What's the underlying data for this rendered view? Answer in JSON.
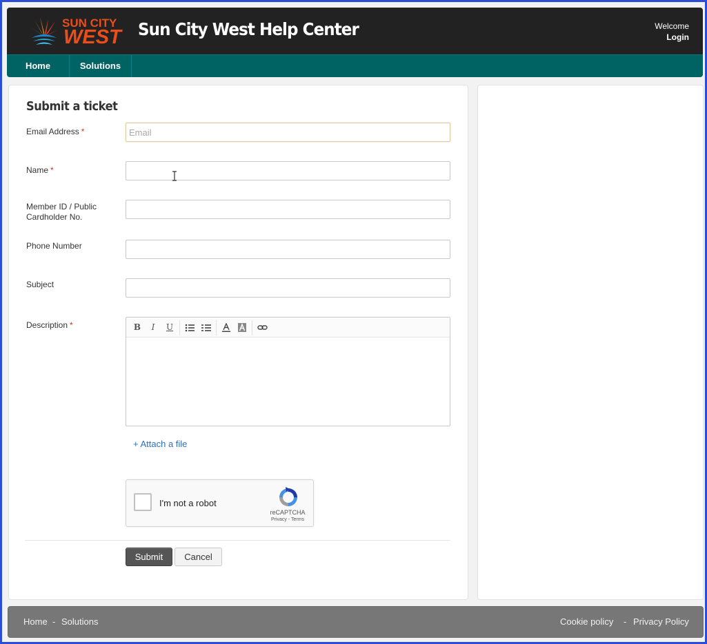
{
  "header": {
    "logo_top": "SUN CITY",
    "logo_bottom": "WEST",
    "title": "Sun City West Help Center",
    "welcome": "Welcome",
    "login": "Login"
  },
  "nav": {
    "home": "Home",
    "solutions": "Solutions"
  },
  "form": {
    "title": "Submit a ticket",
    "required_mark": "*",
    "email_label": "Email Address",
    "email_placeholder": "Email",
    "name_label": "Name",
    "member_label_line1": "Member ID / Public",
    "member_label_line2": "Cardholder No.",
    "phone_label": "Phone Number",
    "subject_label": "Subject",
    "description_label": "Description",
    "toolbar": {
      "bold": "B",
      "italic": "I",
      "underline": "U"
    },
    "attach": "+ Attach a file",
    "captcha_label": "I'm not a robot",
    "captcha_brand": "reCAPTCHA",
    "captcha_links": "Privacy - Terms",
    "submit": "Submit",
    "cancel": "Cancel"
  },
  "footer": {
    "home": "Home",
    "solutions": "Solutions",
    "separator": "-",
    "cookie": "Cookie policy",
    "privacy": "Privacy Policy"
  }
}
